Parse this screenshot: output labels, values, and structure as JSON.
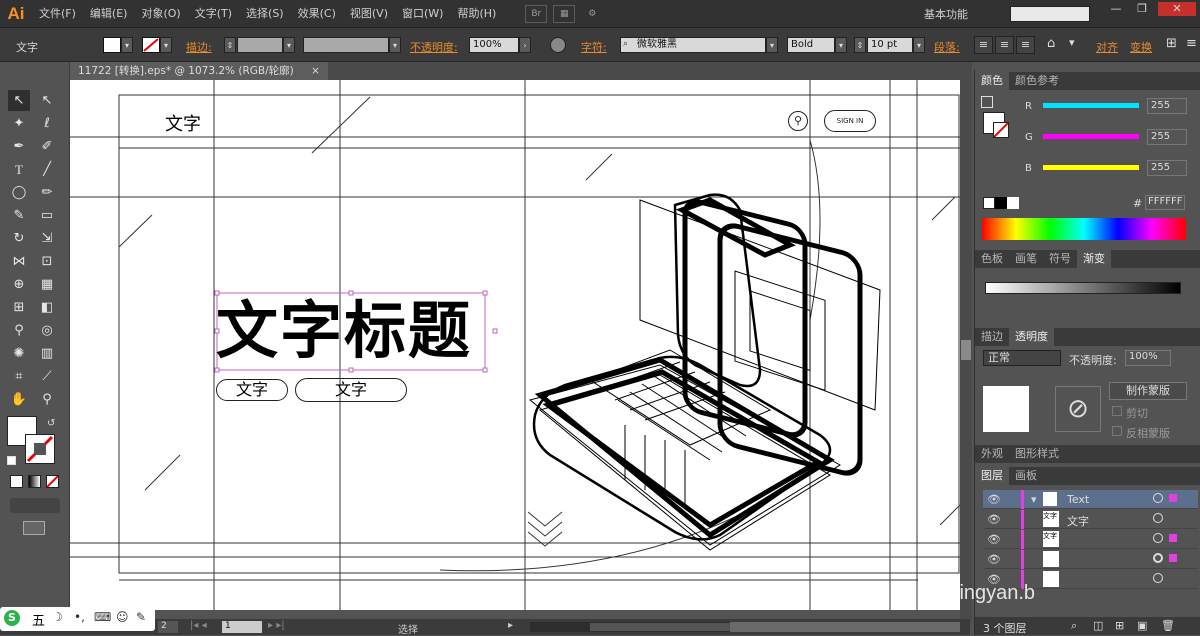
{
  "app": {
    "logo": "Ai"
  },
  "menu": [
    "文件(F)",
    "编辑(E)",
    "对象(O)",
    "文字(T)",
    "选择(S)",
    "效果(C)",
    "视图(V)",
    "窗口(W)",
    "帮助(H)"
  ],
  "menubar_icon": "Br",
  "workspace": "基本功能",
  "window_buttons": {
    "minimize": "—",
    "restore": "❐",
    "close": "✕"
  },
  "control": {
    "tool_label": "文字",
    "stroke_label": "描边:",
    "opacity_label": "不透明度:",
    "opacity_value": "100%",
    "char_label": "字符:",
    "font_name": "微软雅黑",
    "font_style": "Bold",
    "font_size": "10 pt",
    "para_label": "段落:",
    "align_label": "对齐",
    "transform_label": "变换"
  },
  "document": {
    "tab_title": "11722 [转换].eps* @ 1073.2% (RGB/轮廓)",
    "close_glyph": "×"
  },
  "artboard": {
    "header_text": "文字",
    "pill_button_text": "SIGN IN",
    "headline": "文字标题",
    "pill1": "文字",
    "pill2": "文字"
  },
  "panels": {
    "color_tabs": [
      "颜色",
      "颜色参考"
    ],
    "rgb": [
      {
        "channel": "R",
        "value": "255",
        "color": "#00e5ff"
      },
      {
        "channel": "G",
        "value": "255",
        "color": "#ff00ff"
      },
      {
        "channel": "B",
        "value": "255",
        "color": "#ffff00"
      }
    ],
    "hex_label": "#",
    "hex_value": "FFFFFF",
    "swatch_tabs": [
      "色板",
      "画笔",
      "符号",
      "渐变"
    ],
    "transparency_tabs": [
      "描边",
      "透明度"
    ],
    "blend_mode": "正常",
    "opacity_label": "不透明度:",
    "opacity_value": "100%",
    "make_mask": "制作蒙版",
    "clip": "剪切",
    "invert_mask": "反相蒙版",
    "appearance_tabs": [
      "外观",
      "图形样式"
    ],
    "layers_tabs": [
      "图层",
      "画板"
    ],
    "layers": [
      {
        "name": "Text",
        "thumb": ""
      },
      {
        "name": "文字",
        "thumb": "文字"
      },
      {
        "name": "",
        "thumb": "文字"
      },
      {
        "name": "",
        "thumb": ""
      },
      {
        "name": "",
        "thumb": ""
      }
    ],
    "layer_count": "3 个图层"
  },
  "status": {
    "zoom": "2",
    "page": "1",
    "tool": "选择"
  },
  "ime": {
    "label": "五"
  },
  "watermark": "jingyan.b"
}
